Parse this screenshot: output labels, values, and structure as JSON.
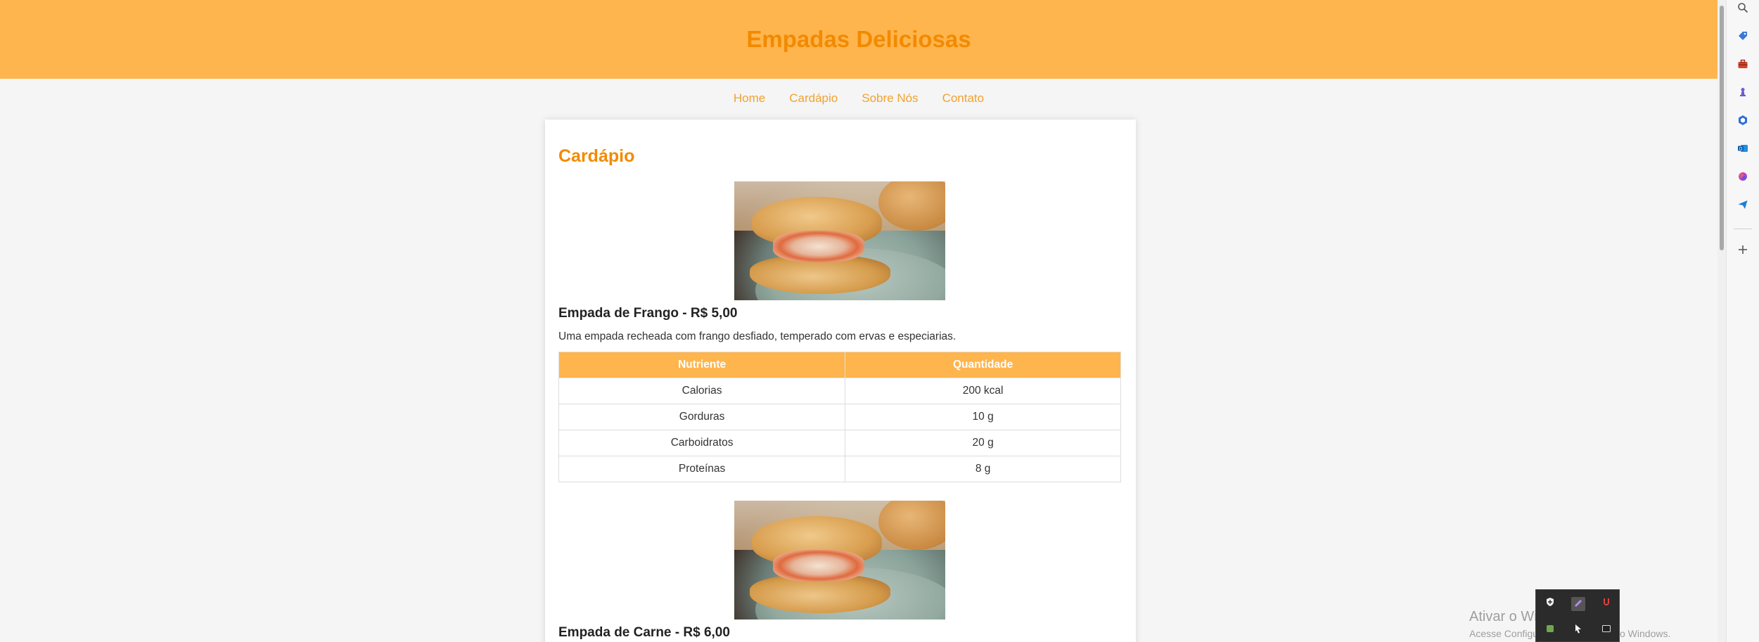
{
  "site": {
    "title": "Empadas Deliciosas"
  },
  "nav": [
    {
      "label": "Home"
    },
    {
      "label": "Cardápio"
    },
    {
      "label": "Sobre Nós"
    },
    {
      "label": "Contato"
    }
  ],
  "menu": {
    "title": "Cardápio",
    "products": [
      {
        "name": "Empada de Frango - R$ 5,00",
        "description": "Uma empada recheada com frango desfiado, temperado com ervas e especiarias.",
        "table": {
          "headers": [
            "Nutriente",
            "Quantidade"
          ],
          "rows": [
            [
              "Calorias",
              "200 kcal"
            ],
            [
              "Gorduras",
              "10 g"
            ],
            [
              "Carboidratos",
              "20 g"
            ],
            [
              "Proteínas",
              "8 g"
            ]
          ]
        }
      },
      {
        "name": "Empada de Carne - R$ 6,00"
      }
    ]
  },
  "colors": {
    "header_bg": "#ffb54d",
    "title": "#f28a00",
    "nav_link": "#f2a22e"
  },
  "sidebar_icons": [
    "search-icon",
    "tag-icon",
    "toolbox-icon",
    "chess-icon",
    "office-icon",
    "outlook-icon",
    "copilot-icon",
    "send-icon",
    "add-icon"
  ],
  "tray_icons": [
    "shield-icon",
    "pen-icon",
    "magnet-icon",
    "app-icon",
    "cursor-icon",
    "app-icon"
  ],
  "windows": {
    "activate_title": "Ativar o Windows",
    "activate_sub": "Acesse Configurações para ativar o Windows."
  }
}
